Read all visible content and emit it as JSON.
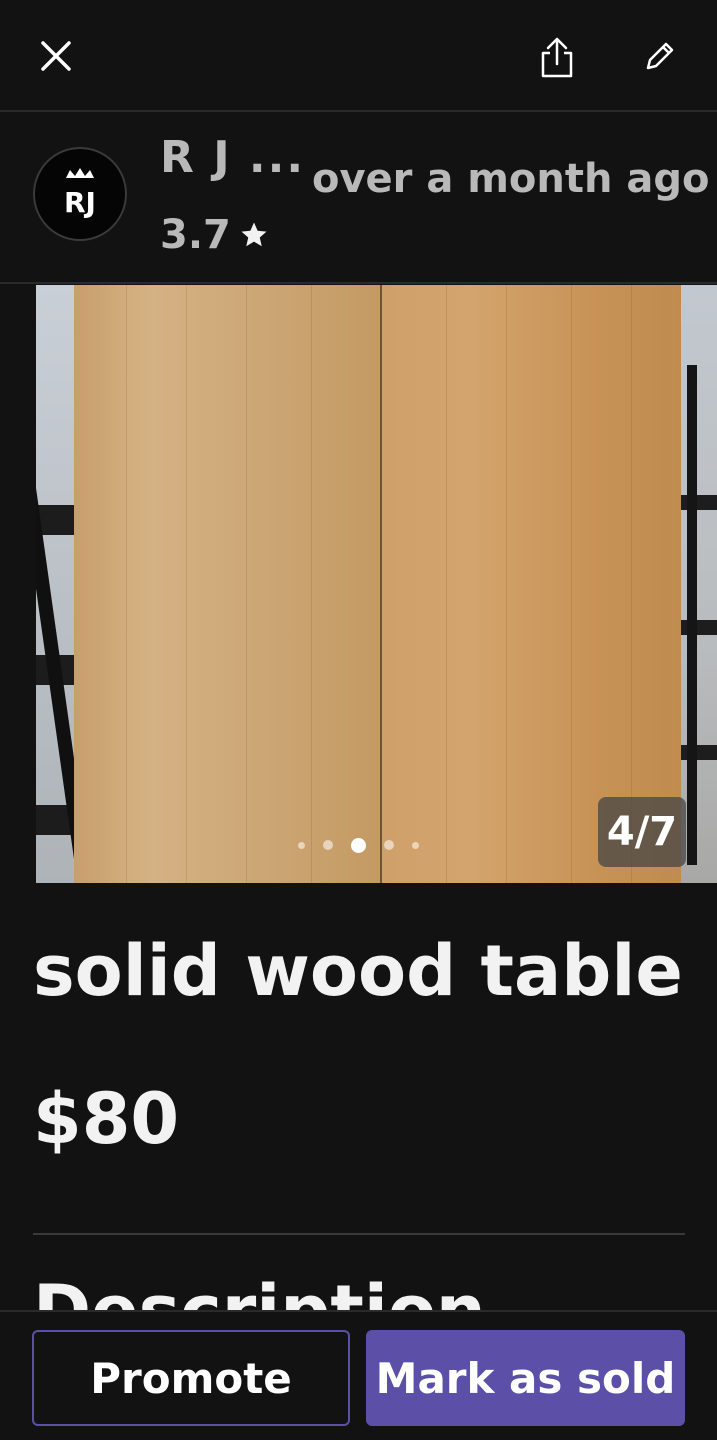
{
  "header": {
    "close_icon": "close-icon",
    "share_icon": "share-icon",
    "edit_icon": "pencil-icon"
  },
  "seller": {
    "name": "R J ...",
    "rating": "3.7",
    "rating_icon": "star-icon",
    "posted": "over a month  ago",
    "avatar_text": "RJ"
  },
  "gallery": {
    "counter": "4/7",
    "current_index": 4,
    "total": 7
  },
  "listing": {
    "title": "solid wood table",
    "price": "$80",
    "section_heading": "Description"
  },
  "actions": {
    "promote_label": "Promote",
    "mark_sold_label": "Mark as sold"
  },
  "colors": {
    "background": "#121212",
    "accent": "#5b4fa8",
    "muted_text": "#b9b9b9"
  }
}
